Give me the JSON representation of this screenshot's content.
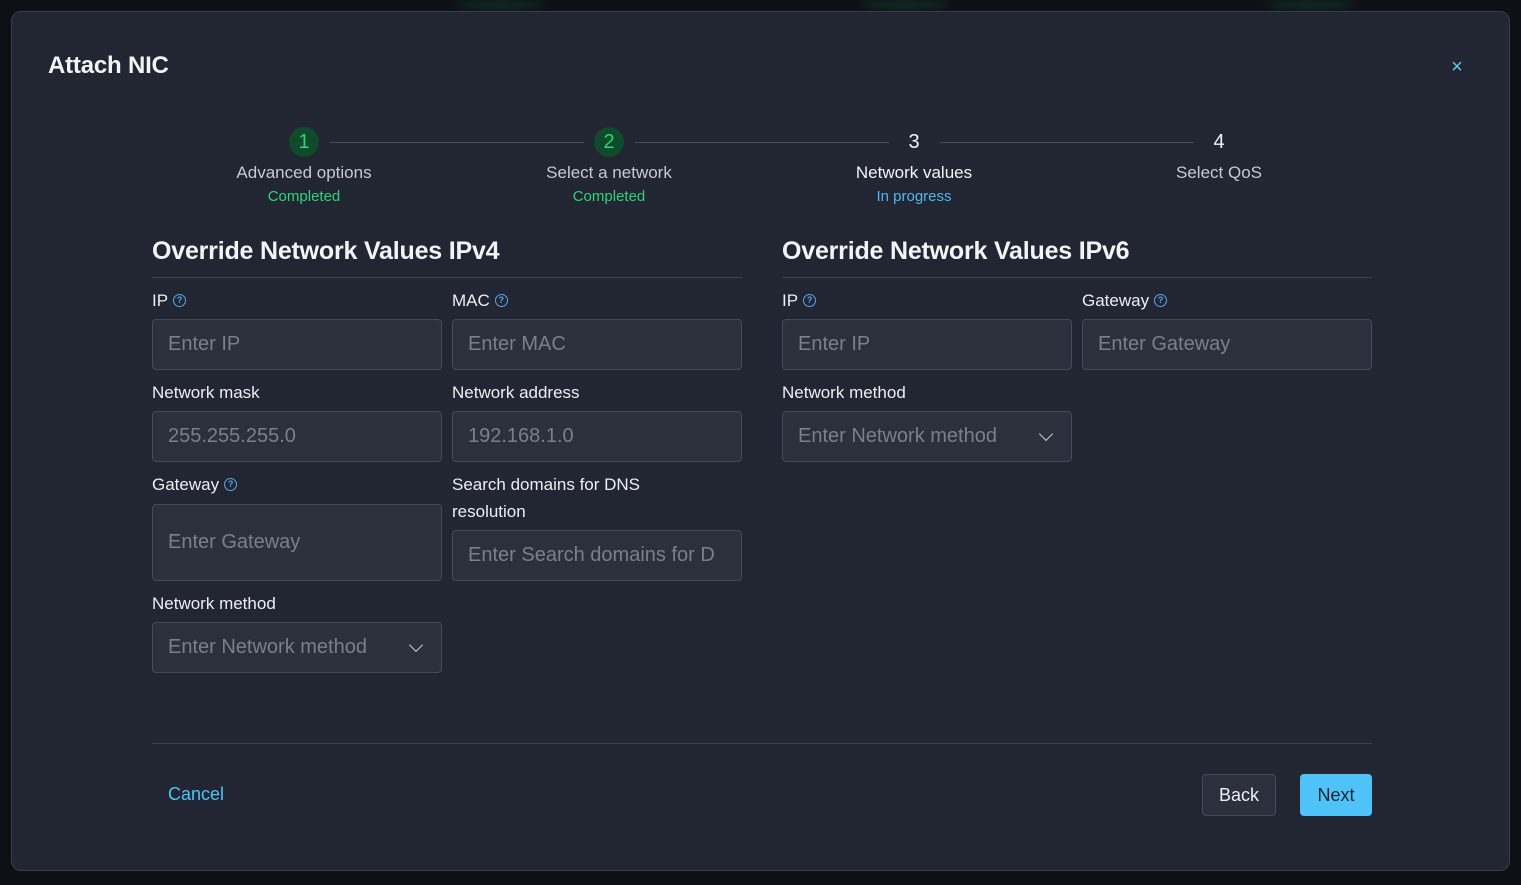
{
  "modal": {
    "title": "Attach NIC",
    "close_label": "×"
  },
  "stepper": [
    {
      "number": "1",
      "name": "Advanced options",
      "status": "Completed"
    },
    {
      "number": "2",
      "name": "Select a network",
      "status": "Completed"
    },
    {
      "number": "3",
      "name": "Network values",
      "status": "In progress"
    },
    {
      "number": "4",
      "name": "Select QoS",
      "status": ""
    }
  ],
  "ipv4": {
    "title": "Override Network Values IPv4",
    "ip": {
      "label": "IP",
      "placeholder": "Enter IP"
    },
    "mac": {
      "label": "MAC",
      "placeholder": "Enter MAC"
    },
    "netmask": {
      "label": "Network mask",
      "placeholder": "255.255.255.0"
    },
    "netaddr": {
      "label": "Network address",
      "placeholder": "192.168.1.0"
    },
    "gateway": {
      "label": "Gateway",
      "placeholder": "Enter Gateway"
    },
    "dns": {
      "label": "Search domains for DNS resolution",
      "placeholder": "Enter Search domains for D"
    },
    "method": {
      "label": "Network method",
      "placeholder": "Enter Network method"
    }
  },
  "ipv6": {
    "title": "Override Network Values IPv6",
    "ip": {
      "label": "IP",
      "placeholder": "Enter IP"
    },
    "gateway": {
      "label": "Gateway",
      "placeholder": "Enter Gateway"
    },
    "method": {
      "label": "Network method",
      "placeholder": "Enter Network method"
    }
  },
  "footer": {
    "cancel": "Cancel",
    "back": "Back",
    "next": "Next"
  },
  "icons": {
    "help": "question-circle-icon",
    "close": "close-icon",
    "dropdown": "chevron-down-icon"
  },
  "colors": {
    "accent": "#4fc3f7",
    "completed": "#2ed47a",
    "in_progress": "#4fb8ea",
    "modal_bg": "#222532"
  }
}
